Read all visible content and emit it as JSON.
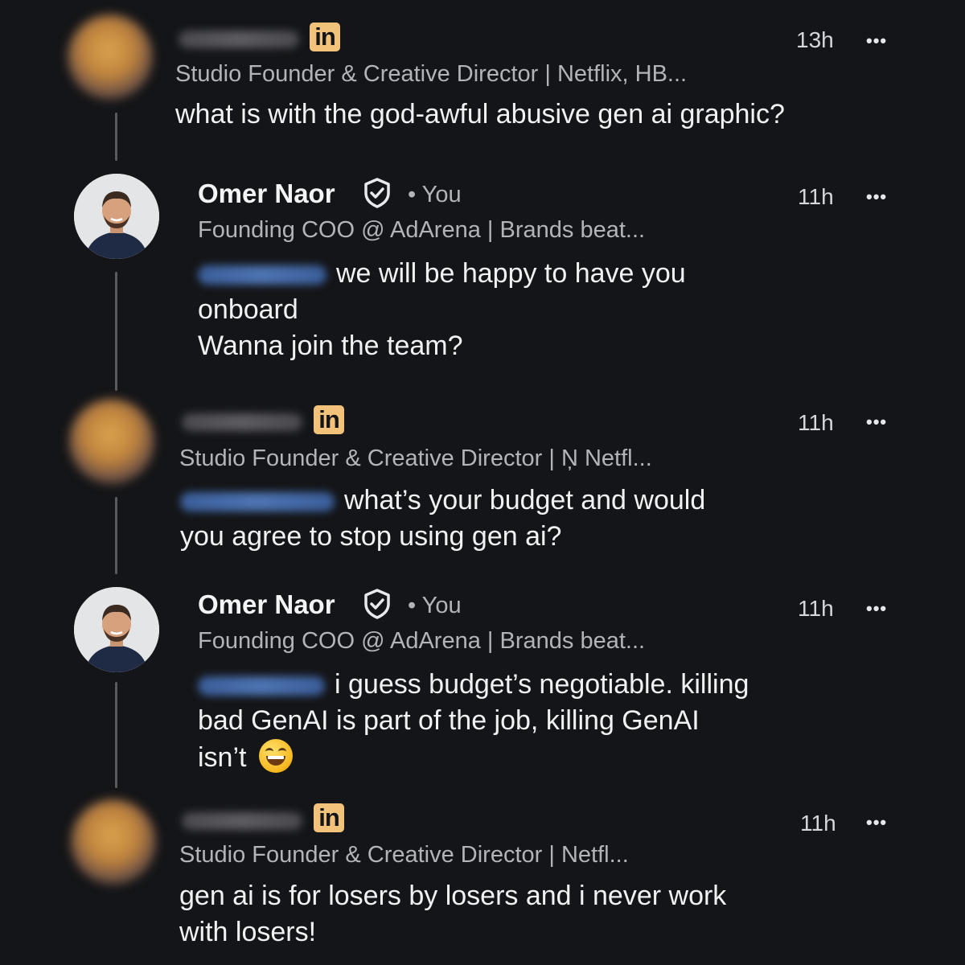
{
  "comments": [
    {
      "author_type": "blurred",
      "headline": "Studio Founder & Creative Director | Netflix, HB...",
      "time": "13h",
      "more": "•••",
      "mention": "",
      "text": "what is with the god-awful abusive gen ai graphic?"
    },
    {
      "author_type": "named",
      "author": "Omer Naor",
      "you": "• You",
      "headline": "Founding COO @ AdArena | Brands beat...",
      "time": "11h",
      "more": "•••",
      "line1": "we will be happy to have you",
      "line2": "onboard",
      "line3": "Wanna join the team?"
    },
    {
      "author_type": "blurred",
      "headline": "Studio Founder & Creative Director | Ņ Netfl...",
      "time": "11h",
      "more": "•••",
      "line1": "what’s your budget and would",
      "line2": "you agree to stop using gen ai?"
    },
    {
      "author_type": "named",
      "author": "Omer Naor",
      "you": "• You",
      "headline": "Founding COO @ AdArena | Brands beat...",
      "time": "11h",
      "more": "•••",
      "line1": "i guess budget’s negotiable. killing",
      "line2": "bad GenAI is part of the job, killing GenAI",
      "line3": "isn’t"
    },
    {
      "author_type": "blurred",
      "headline": "Studio Founder & Creative Director | Netfl...",
      "time": "11h",
      "more": "•••",
      "line1": "gen ai is for losers by losers and i never work",
      "line2": "with losers!"
    }
  ],
  "badge_label": "in",
  "icons": {
    "verified": "verified-shield-icon",
    "linkedin": "linkedin-badge-icon",
    "more": "more-options-icon",
    "emoji": "grinning-face-emoji"
  },
  "colors": {
    "background": "#141518",
    "badge": "#f2c27a",
    "mention": "#4e74b2",
    "thread_line": "#5a5b5f"
  }
}
